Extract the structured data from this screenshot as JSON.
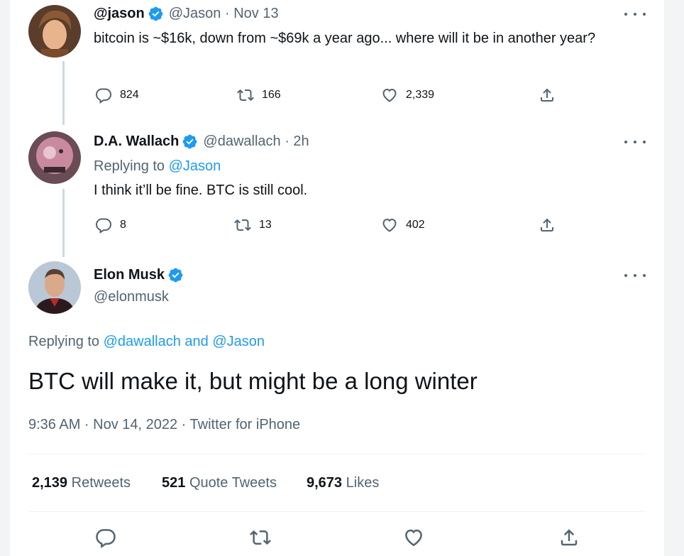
{
  "tweets": [
    {
      "name": "@jason",
      "handle": "@Jason",
      "sep": " · ",
      "time": "Nov 13",
      "text": "bitcoin is ~$16k, down from ~$69k a year ago... where will it be in another year?",
      "replies": "824",
      "retweets": "166",
      "likes": "2,339"
    },
    {
      "name": "D.A. Wallach",
      "handle": "@dawallach",
      "sep": " · ",
      "time": "2h",
      "replying_prefix": "Replying to ",
      "replying_to": "@Jason",
      "text": "I think it’ll be fine. BTC is still cool.",
      "replies": "8",
      "retweets": "13",
      "likes": "402"
    }
  ],
  "main": {
    "name": "Elon Musk",
    "handle": "@elonmusk",
    "replying_prefix": "Replying to ",
    "replying_to": "@dawallach and @Jason",
    "text": "BTC will make it, but might be a long winter",
    "timestamp": "9:36 AM · Nov 14, 2022 · Twitter for iPhone",
    "retweets_count": "2,139",
    "retweets_label": "Retweets",
    "quotes_count": "521",
    "quotes_label": "Quote Tweets",
    "likes_count": "9,673",
    "likes_label": "Likes"
  },
  "colors": {
    "accent": "#1d9bf0",
    "muted": "#536471",
    "text": "#0f1419"
  }
}
